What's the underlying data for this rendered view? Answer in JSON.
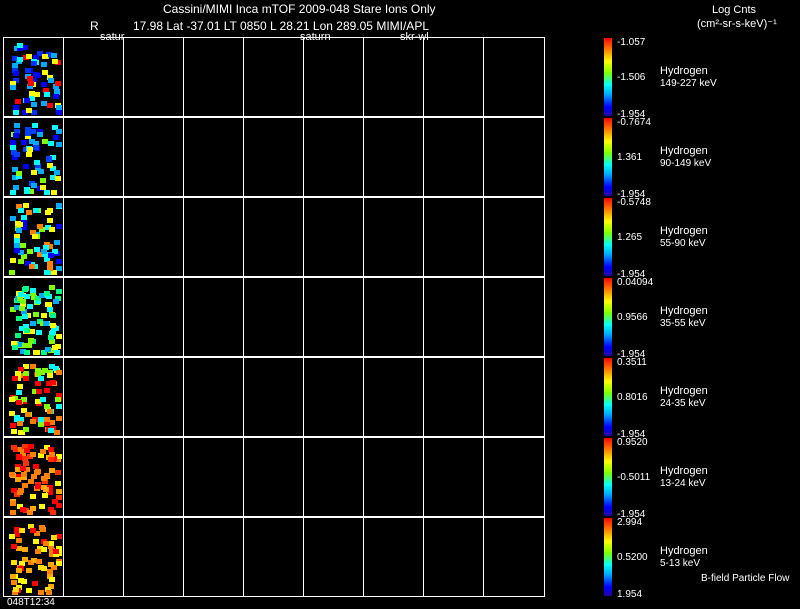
{
  "header": {
    "title": "Cassini/MIMI Inca mTOF  2009-048   Stare    Ions Only",
    "log_cnts": "Log Cnts",
    "units": "(cm²-sr-s-keV)⁻¹",
    "r_label": "R",
    "ephemeris": "17.98 Lat -37.01 LT 0850 L        28.21 Lon          289.05  MIMI/APL",
    "body_a": "satur",
    "body_b": "saturn",
    "body_c": "skr-wl"
  },
  "rows": [
    {
      "species": "Hydrogen",
      "energy": "149-227 keV",
      "scale_top": "-1.057",
      "scale_mid": "-1.506",
      "scale_bot": "-1.954"
    },
    {
      "species": "Hydrogen",
      "energy": "90-149 keV",
      "scale_top": "-0.7674",
      "scale_mid": "1.361",
      "scale_bot": "-1.954"
    },
    {
      "species": "Hydrogen",
      "energy": "55-90 keV",
      "scale_top": "-0.5748",
      "scale_mid": "1.265",
      "scale_bot": "-1.954"
    },
    {
      "species": "Hydrogen",
      "energy": "35-55 keV",
      "scale_top": "0.04094",
      "scale_mid": "0.9566",
      "scale_bot": "-1.954"
    },
    {
      "species": "Hydrogen",
      "energy": "24-35 keV",
      "scale_top": "0.3511",
      "scale_mid": "0.8016",
      "scale_bot": "-1.954"
    },
    {
      "species": "Hydrogen",
      "energy": "13-24 keV",
      "scale_top": "0.9520",
      "scale_mid": "-0.5011",
      "scale_bot": "-1.954"
    },
    {
      "species": "Hydrogen",
      "energy": "5-13 keV",
      "scale_top": "2.994",
      "scale_mid": "0.5200",
      "scale_bot": "1.954"
    }
  ],
  "footer": {
    "time": "048T12:34",
    "bfield": "B-field Particle Flow"
  },
  "colors": {
    "background": "#000000",
    "grid": "#ffffff",
    "text": "#ffffff"
  }
}
